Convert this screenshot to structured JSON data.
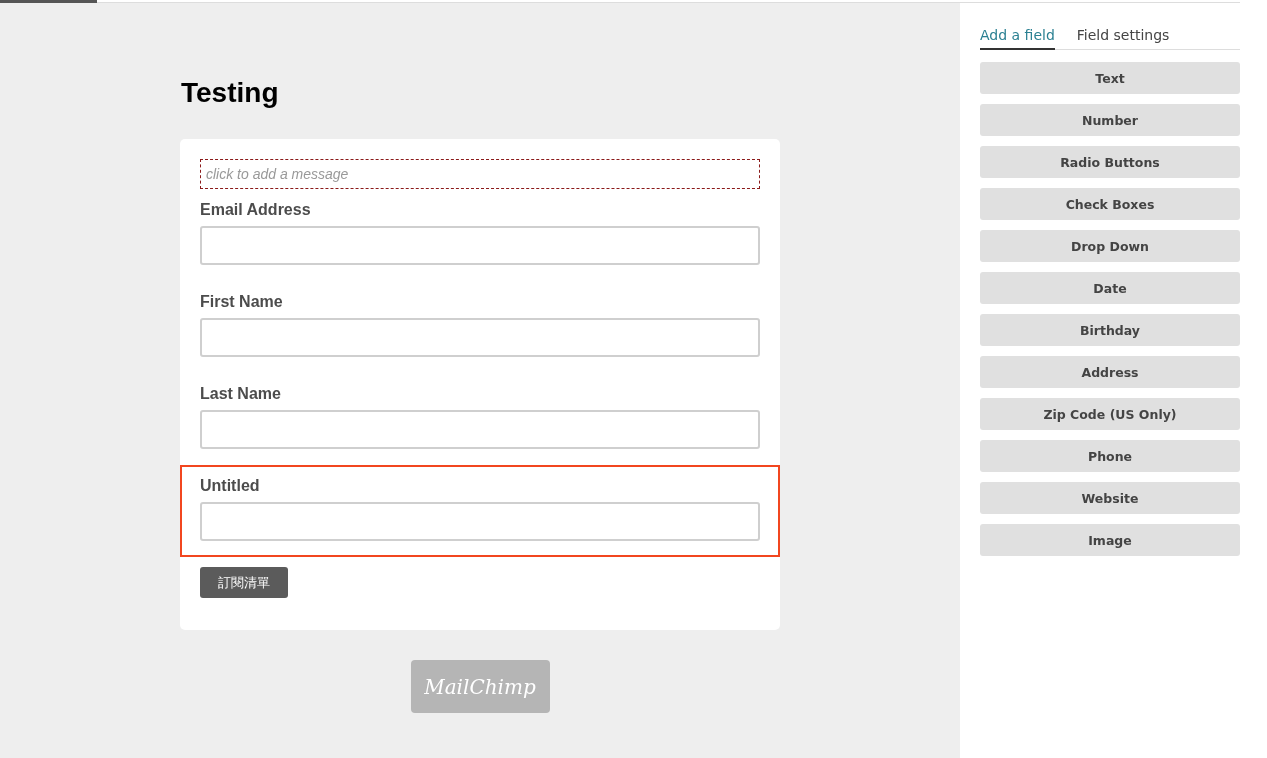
{
  "form": {
    "title": "Testing",
    "message": {
      "placeholder": "click to add a message"
    },
    "fields": [
      {
        "label": "Email Address",
        "selected": false
      },
      {
        "label": "First Name",
        "selected": false
      },
      {
        "label": "Last Name",
        "selected": false
      },
      {
        "label": "Untitled",
        "selected": true
      }
    ],
    "submit_button": "訂閱清單"
  },
  "footer_logo": "MailChimp",
  "sidebar": {
    "tabs": [
      {
        "label": "Add a field",
        "selected": true
      },
      {
        "label": "Field settings",
        "selected": false
      }
    ],
    "field_types": [
      "Text",
      "Number",
      "Radio Buttons",
      "Check Boxes",
      "Drop Down",
      "Date",
      "Birthday",
      "Address",
      "Zip Code (US Only)",
      "Phone",
      "Website",
      "Image"
    ]
  }
}
